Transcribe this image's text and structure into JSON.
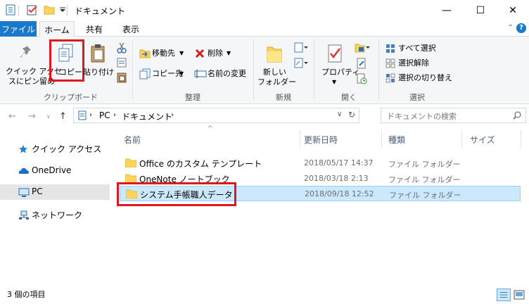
{
  "window": {
    "title": "ドキュメント",
    "minimize": "—",
    "maximize": "☐",
    "close": "✕"
  },
  "tabs": [
    {
      "label": "ファイル",
      "active": false
    },
    {
      "label": "ホーム",
      "active": true
    },
    {
      "label": "共有",
      "active": false
    },
    {
      "label": "表示",
      "active": false
    }
  ],
  "ribbon": {
    "clipboard": {
      "pin_label_1": "クイック アクセ",
      "pin_label_2": "スにピン留め",
      "copy_label": "コピー",
      "paste_label": "貼り付け",
      "group_label": "クリップボード"
    },
    "organize": {
      "move_label": "移動先",
      "copy_to_label": "コピー先",
      "delete_label": "削除",
      "rename_label": "名前の変更",
      "group_label": "整理"
    },
    "new": {
      "new_folder_1": "新しい",
      "new_folder_2": "フォルダー",
      "group_label": "新規"
    },
    "open": {
      "properties_label": "プロパティ",
      "group_label": "開く"
    },
    "select": {
      "select_all": "すべて選択",
      "select_none": "選択解除",
      "invert": "選択の切り替え",
      "group_label": "選択"
    }
  },
  "address": {
    "crumbs": [
      "PC",
      "ドキュメント"
    ],
    "search_placeholder": "ドキュメントの検索"
  },
  "nav_pane": [
    {
      "label": "クイック アクセス",
      "icon": "star-icon",
      "selected": false
    },
    {
      "label": "OneDrive",
      "icon": "cloud-icon",
      "selected": false
    },
    {
      "label": "PC",
      "icon": "monitor-icon",
      "selected": true
    },
    {
      "label": "ネットワーク",
      "icon": "network-icon",
      "selected": false
    }
  ],
  "columns": {
    "name": "名前",
    "date": "更新日時",
    "type": "種類",
    "size": "サイズ"
  },
  "files": [
    {
      "name": "Office のカスタム テンプレート",
      "date": "2018/05/17 14:37",
      "type": "ファイル フォルダー",
      "size": ""
    },
    {
      "name": "OneNote ノートブック",
      "date": "2018/03/18 2:13",
      "type": "ファイル フォルダー",
      "size": ""
    },
    {
      "name": "システム手帳職人データ",
      "date": "2018/09/18 12:52",
      "type": "ファイル フォルダー",
      "size": ""
    }
  ],
  "status": {
    "item_count": "3 個の項目"
  },
  "colors": {
    "accent": "#1979ca",
    "highlight_red": "#e0181b",
    "selection": "#cce8ff",
    "folder_yellow": "#ffd45a"
  }
}
